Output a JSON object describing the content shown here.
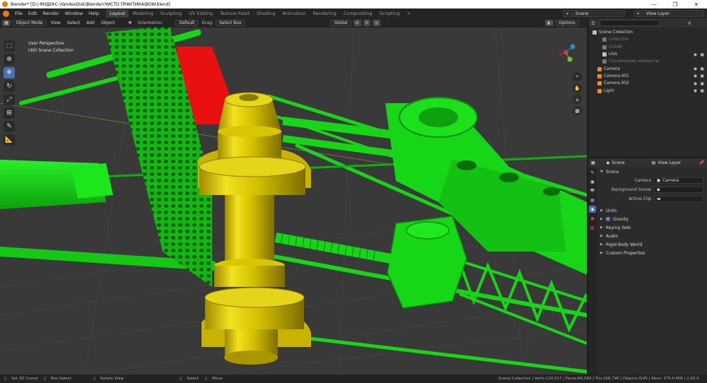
{
  "window": {
    "title": "Blender* [D:\\-ЯНДЕКС-\\YandexDisk\\Blender\\ЧИСТО ПРАКТИКА\\BOW.blend]",
    "minimize": "—",
    "maximize": "❐",
    "close": "✕"
  },
  "menu": [
    "File",
    "Edit",
    "Render",
    "Window",
    "Help"
  ],
  "workspaces": [
    {
      "label": "Layout",
      "active": true
    },
    {
      "label": "Modeling"
    },
    {
      "label": "Sculpting"
    },
    {
      "label": "UV Editing"
    },
    {
      "label": "Texture Paint"
    },
    {
      "label": "Shading"
    },
    {
      "label": "Animation"
    },
    {
      "label": "Rendering"
    },
    {
      "label": "Compositing"
    },
    {
      "label": "Scripting"
    }
  ],
  "scene_selector": "Scene",
  "view_layer_selector": "View Layer",
  "viewport_header": {
    "mode": "Object Mode",
    "view": "View",
    "select": "Select",
    "add": "Add",
    "object": "Object",
    "orientation_label": "Orientation:",
    "orientation_value": "Default",
    "drag_label": "Drag:",
    "drag_value": "Select Box",
    "transform": "Global",
    "options": "Options"
  },
  "viewport_info": {
    "perspective": "User Perspective",
    "collection": "(49) Scene Collection"
  },
  "outliner": {
    "rows": [
      {
        "label": "Scene Collection",
        "indent": 0,
        "icon_color": "#bdbdbd"
      },
      {
        "label": "Collection",
        "indent": 2,
        "icon_color": "#777777",
        "dim": true
      },
      {
        "label": "CLEAR",
        "indent": 2,
        "icon_color": "#777777",
        "dim": true
      },
      {
        "label": "LIVs",
        "indent": 2,
        "icon_color": "#bdbdbd",
        "eye": true
      },
      {
        "label": "Технические элементы",
        "indent": 2,
        "icon_color": "#777777",
        "dim": true
      },
      {
        "label": "Camera",
        "indent": 1,
        "icon_color": "#e88a36",
        "eye": true
      },
      {
        "label": "Camera.001",
        "indent": 1,
        "icon_color": "#e88a36",
        "eye": true
      },
      {
        "label": "Camera.002",
        "indent": 1,
        "icon_color": "#e88a36",
        "eye": true
      },
      {
        "label": "Light",
        "indent": 1,
        "icon_color": "#e88a36",
        "eye": true
      }
    ]
  },
  "properties": {
    "scene_label": "Scene",
    "view_layer_label": "View Layer",
    "panel_scene": "Scene",
    "camera_label": "Camera",
    "camera_value": "Camera",
    "background_scene_label": "Background Scene",
    "active_clip_label": "Active Clip",
    "panels": [
      "Units",
      "Gravity",
      "Keying Sets",
      "Audio",
      "Rigid Body World",
      "Custom Properties"
    ]
  },
  "statusbar": {
    "set_cursor": "Set 3D Cursor",
    "box_select": "Box Select",
    "rotate_view": "Rotate View",
    "select": "Select",
    "move": "Move",
    "stats": "Scene Collection | Verts:120,517 | Faces:84,589 | Tris:168,796 | Objects:0/45 | Mem: 375.6 MiB | 2.83.5"
  },
  "colors": {
    "green": "#17d617",
    "yellow": "#e0c800",
    "red": "#e81010",
    "accent": "#4772b3"
  }
}
